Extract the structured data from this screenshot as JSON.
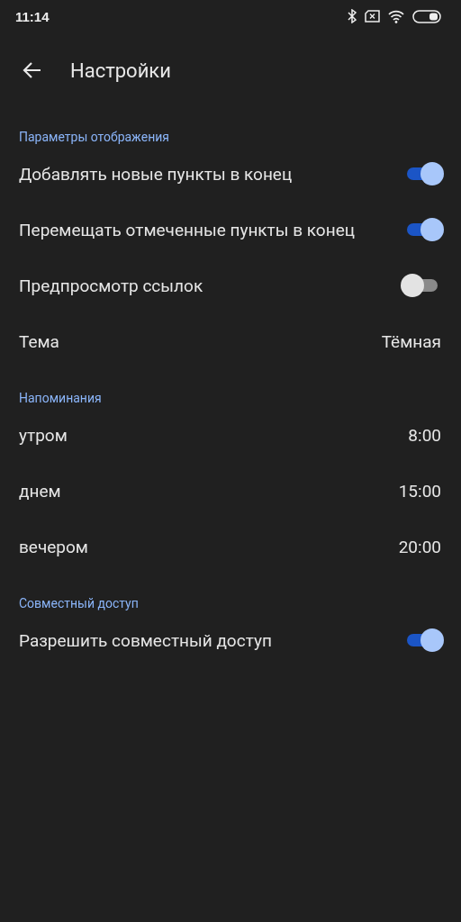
{
  "status_bar": {
    "time": "11:14"
  },
  "app_bar": {
    "title": "Настройки"
  },
  "sections": [
    {
      "title": "Параметры отображения",
      "rows": [
        {
          "kind": "switch",
          "label": "Добавлять новые пункты в конец",
          "on": true
        },
        {
          "kind": "switch",
          "label": "Перемещать отмеченные пункты в конец",
          "on": true
        },
        {
          "kind": "switch",
          "label": "Предпросмотр ссылок",
          "on": false
        },
        {
          "kind": "value",
          "label": "Тема",
          "value": "Тёмная"
        }
      ]
    },
    {
      "title": "Напоминания",
      "rows": [
        {
          "kind": "value",
          "label": "утром",
          "value": "8:00"
        },
        {
          "kind": "value",
          "label": "днем",
          "value": "15:00"
        },
        {
          "kind": "value",
          "label": "вечером",
          "value": "20:00"
        }
      ]
    },
    {
      "title": "Совместный доступ",
      "rows": [
        {
          "kind": "switch",
          "label": "Разрешить совместный доступ",
          "on": true
        }
      ]
    }
  ]
}
